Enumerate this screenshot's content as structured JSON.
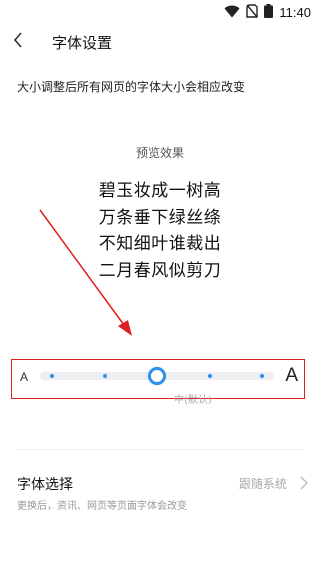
{
  "status_bar": {
    "time": "11:40",
    "icons": [
      "wifi-icon",
      "sim-off-icon",
      "battery-icon"
    ]
  },
  "header": {
    "title": "字体设置",
    "back_icon": "back-arrow-icon"
  },
  "note": "大小调整后所有网页的字体大小会相应改变",
  "preview": {
    "label": "预览效果",
    "lines": [
      "碧玉妆成一树高",
      "万条垂下绿丝绦",
      "不知细叶谁裁出",
      "二月春风似剪刀"
    ]
  },
  "font_size_slider": {
    "small_label": "A",
    "large_label": "A",
    "steps": 5,
    "selected_index": 2,
    "selected_caption": "中(默认)",
    "accent_color": "#2e8ef0",
    "highlight_box_color": "#e02020"
  },
  "font_select": {
    "title": "字体选择",
    "subtitle": "更换后，资讯、网页等页面字体会改变",
    "value": "跟随系统"
  },
  "annotation": {
    "arrow_color": "#e02020"
  }
}
